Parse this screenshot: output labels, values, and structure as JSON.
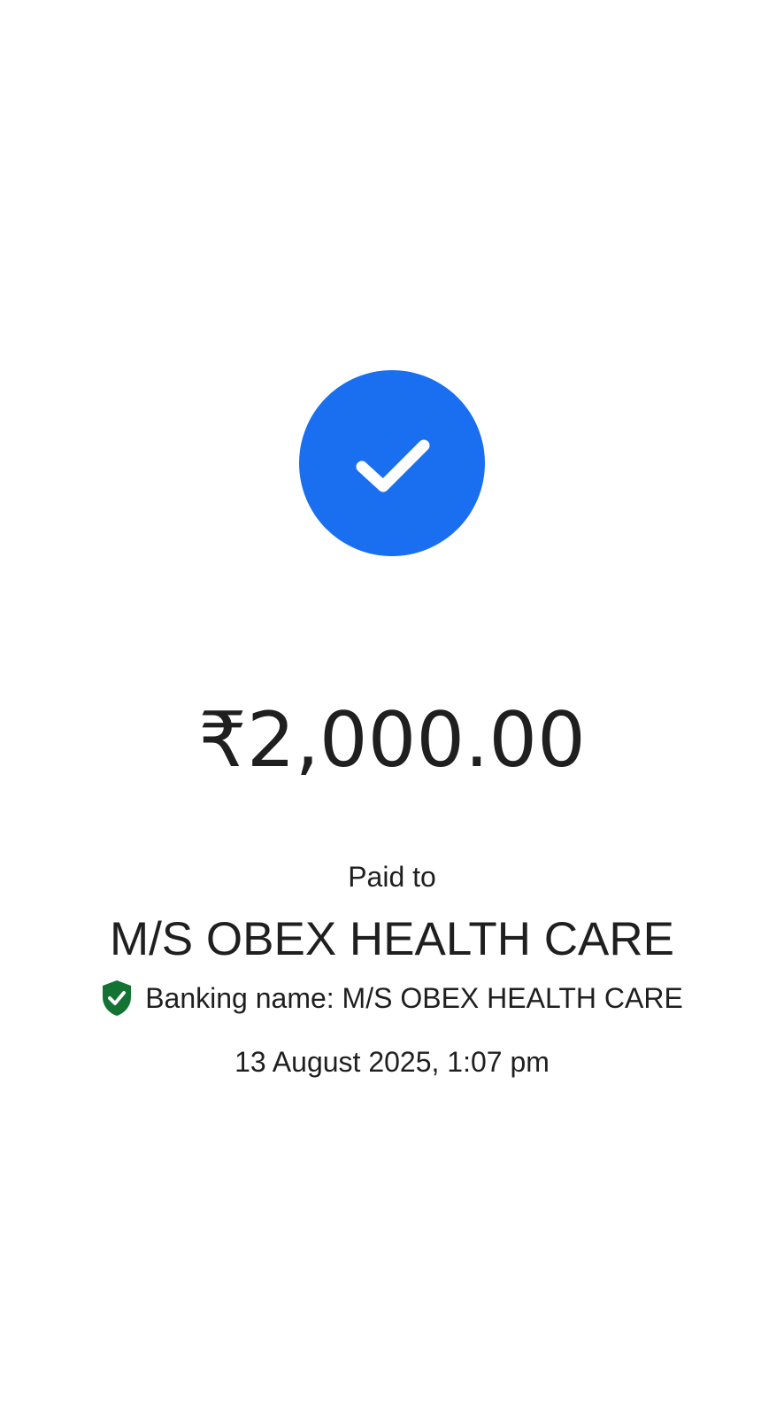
{
  "payment": {
    "status_icon": "checkmark-icon",
    "amount": "₹2,000.00",
    "paid_to_label": "Paid to",
    "payee_name": "M/S OBEX HEALTH CARE",
    "banking_icon": "verified-shield-icon",
    "banking_name_text": "Banking name: M/S OBEX HEALTH CARE",
    "timestamp": "13 August 2025, 1:07 pm"
  },
  "colors": {
    "accent_blue": "#1a6ff0",
    "verified_green": "#137333",
    "text": "#1f1f1f",
    "background": "#ffffff"
  }
}
